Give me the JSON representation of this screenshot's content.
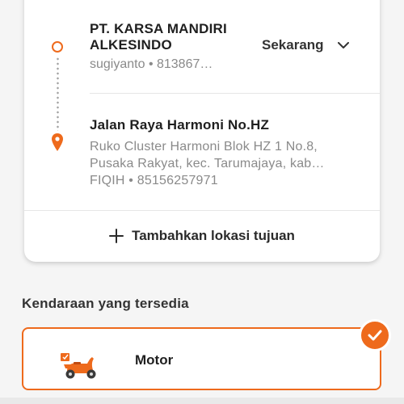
{
  "colors": {
    "accent": "#ee6a1c",
    "muted_text": "#8a8a8a",
    "background": "#f5f5f5"
  },
  "origin": {
    "name": "PT. KARSA MANDIRI ALKESINDO",
    "contact": "sugiyanto • 813867…",
    "icon": "origin-circle-icon"
  },
  "schedule": {
    "selected": "Sekarang",
    "icon": "chevron-down-icon"
  },
  "destination": {
    "name": "Jalan Raya Harmoni No.HZ",
    "address": "Ruko Cluster Harmoni Blok HZ 1 No.8, Pusaka Rakyat, kec. Tarumajaya, kab…",
    "contact": "FIQIH • 85156257971",
    "icon": "location-pin-icon"
  },
  "add_destination": {
    "label": "Tambahkan lokasi tujuan",
    "icon": "plus-icon"
  },
  "vehicles": {
    "title": "Kendaraan yang tersedia",
    "items": [
      {
        "name": "Motor",
        "icon": "motor-scooter-icon",
        "selected": true
      }
    ]
  }
}
